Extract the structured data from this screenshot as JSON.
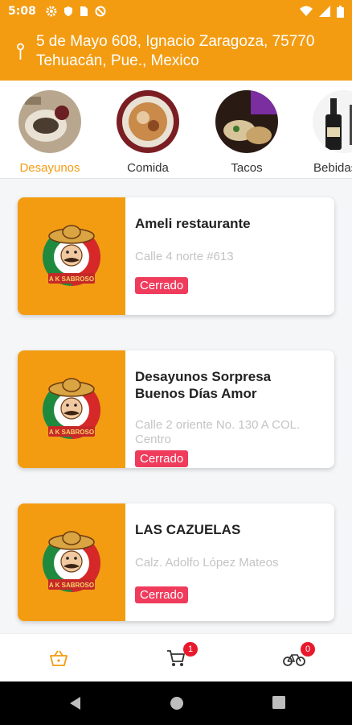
{
  "status_bar": {
    "time": "5:08"
  },
  "header": {
    "address": "5 de Mayo 608, Ignacio Zaragoza, 75770 Tehuacán, Pue., Mexico"
  },
  "categories": [
    {
      "label": "Desayunos",
      "active": true
    },
    {
      "label": "Comida",
      "active": false
    },
    {
      "label": "Tacos",
      "active": false
    },
    {
      "label": "Bebidas",
      "active": false
    }
  ],
  "logo_text": "A K SABROSO",
  "restaurants": [
    {
      "name": "Ameli restaurante",
      "address": "Calle 4 norte #613",
      "status": "Cerrado"
    },
    {
      "name": "Desayunos Sorpresa Buenos Días Amor",
      "address": "Calle 2 oriente No. 130 A COL. Centro",
      "status": "Cerrado"
    },
    {
      "name": "LAS CAZUELAS",
      "address": "Calz. Adolfo López Mateos",
      "status": "Cerrado"
    }
  ],
  "bottom_nav": {
    "cart_count": "1",
    "delivery_count": "0"
  },
  "colors": {
    "accent": "#f39c12",
    "closed_badge": "#ef3b5c",
    "notif_badge": "#e8192c"
  }
}
